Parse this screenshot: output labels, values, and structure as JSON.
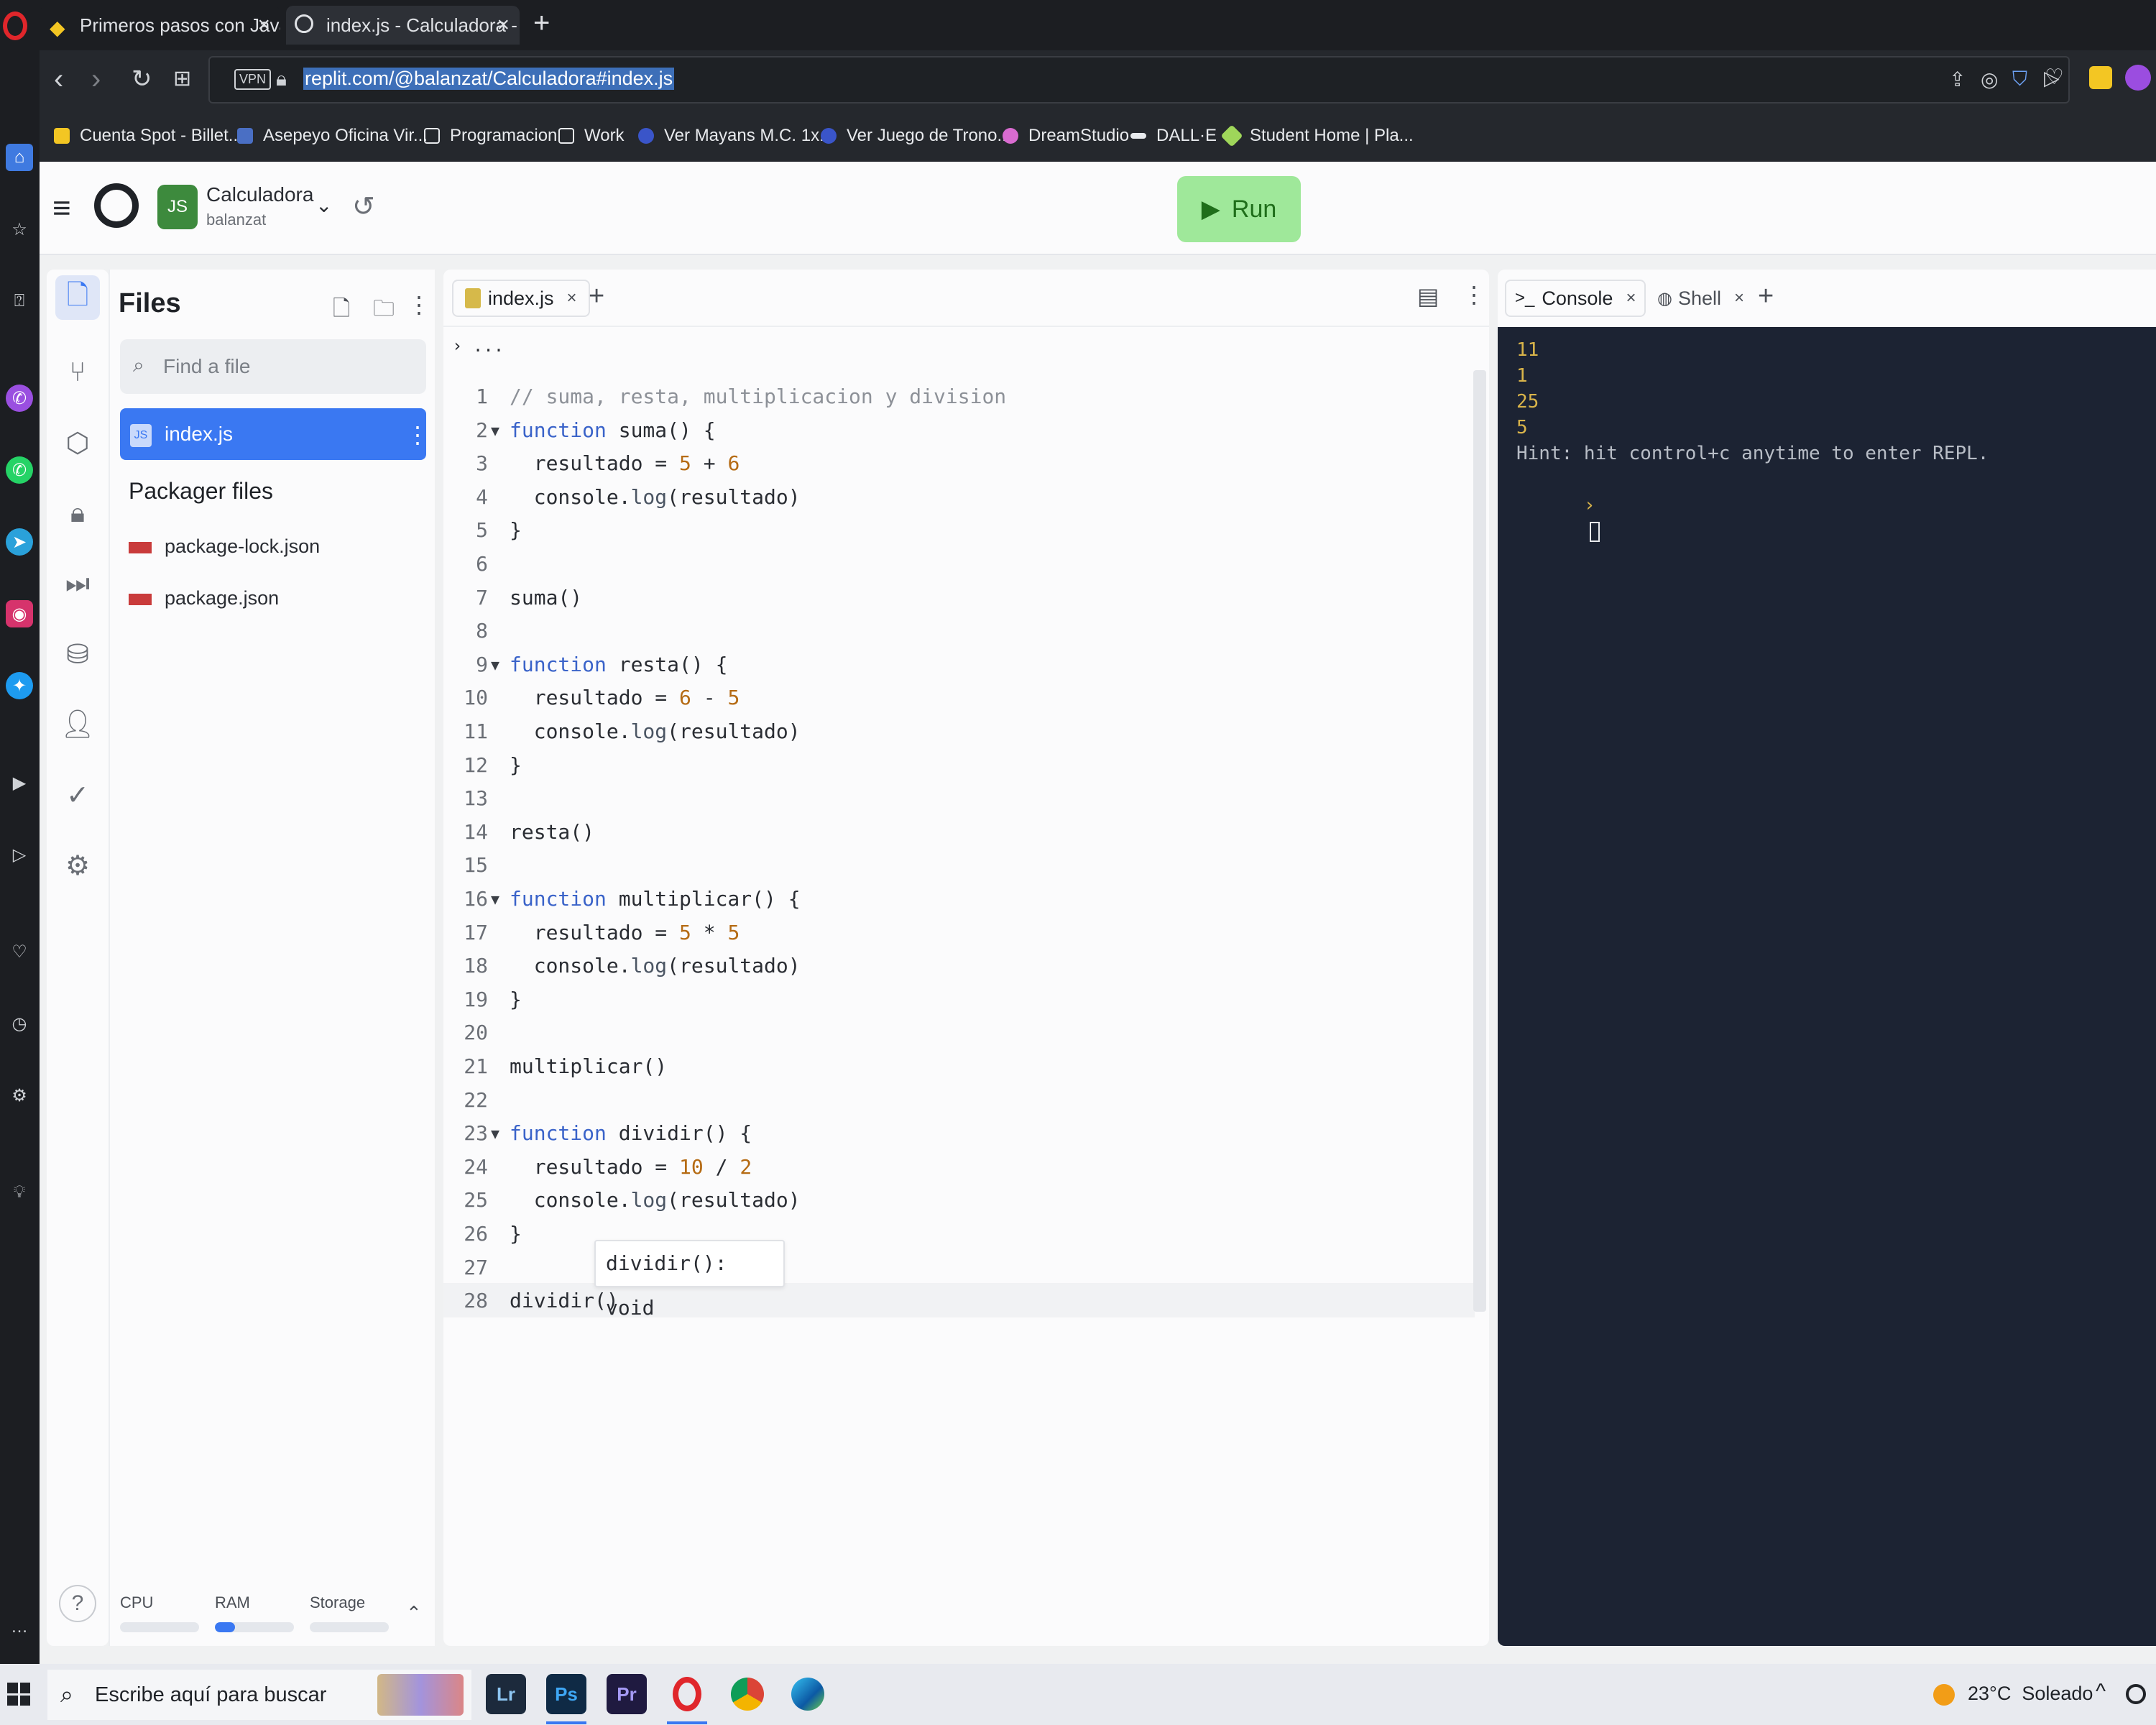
{
  "browser": {
    "tabs": [
      {
        "title": "Primeros pasos con JavaSc"
      },
      {
        "title": "index.js - Calculadora - Rep"
      }
    ],
    "url": "replit.com/@balanzat/Calculadora#index.js",
    "vpn_label": "VPN",
    "bookmarks": [
      "Cuenta Spot - Billet...",
      "Asepeyo Oficina Vir...",
      "Programacion",
      "Work",
      "Ver Mayans M.C. 1x...",
      "Ver Juego de Trono...",
      "DreamStudio",
      "DALL·E",
      "Student Home | Pla..."
    ]
  },
  "header": {
    "project_name": "Calculadora",
    "owner": "balanzat",
    "run_label": "Run"
  },
  "files_panel": {
    "title": "Files",
    "search_placeholder": "Find a file",
    "active_file": "index.js",
    "packager_title": "Packager files",
    "packager_files": [
      "package-lock.json",
      "package.json"
    ]
  },
  "resources": {
    "cpu": "CPU",
    "ram": "RAM",
    "storage": "Storage",
    "ram_usage": 0.25
  },
  "editor": {
    "tab_label": "index.js",
    "breadcrumb": "...",
    "tooltip": "dividir(): void",
    "lines": [
      "// suma, resta, multiplicacion y division",
      "function suma() {",
      "  resultado = 5 + 6",
      "  console.log(resultado)",
      "}",
      "",
      "suma()",
      "",
      "function resta() {",
      "  resultado = 6 - 5",
      "  console.log(resultado)",
      "}",
      "",
      "resta()",
      "",
      "function multiplicar() {",
      "  resultado = 5 * 5",
      "  console.log(resultado)",
      "}",
      "",
      "multiplicar()",
      "",
      "function dividir() {",
      "  resultado = 10 / 2",
      "  console.log(resultado)",
      "}",
      "",
      "dividir()"
    ]
  },
  "console": {
    "tabs": [
      "Console",
      "Shell"
    ],
    "output": [
      "11",
      "1",
      "25",
      "5"
    ],
    "hint": "Hint: hit control+c anytime to enter REPL.",
    "prompt": "›"
  },
  "taskbar": {
    "search_placeholder": "Escribe aquí para buscar",
    "apps": [
      "Lr",
      "Ps",
      "Pr"
    ],
    "weather": "23°C  Soleado"
  },
  "colors": {
    "accent": "#3a78f2",
    "run_button": "#9fe89a",
    "console_bg": "#1c2333",
    "console_output": "#d9b44a"
  }
}
